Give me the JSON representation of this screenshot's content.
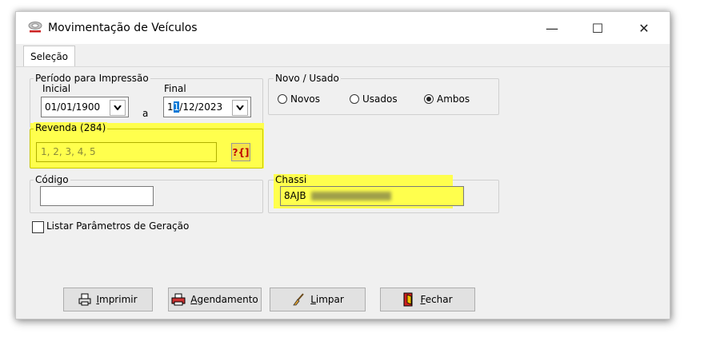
{
  "window": {
    "title": "Movimentação de Veículos",
    "controls": {
      "minimize": "—",
      "maximize": "☐",
      "close": "✕"
    }
  },
  "tabs": {
    "selected": "Seleção"
  },
  "periodo": {
    "legend": "Período para Impressão",
    "inicial_label": "Inicial",
    "inicial_value": "01/01/1900",
    "sep": "a",
    "final_label": "Final",
    "final_value_pre": "1",
    "final_value_sel": "1",
    "final_value_post": "/12/2023"
  },
  "novo_usado": {
    "legend": "Novo / Usado",
    "options": [
      "Novos",
      "Usados",
      "Ambos"
    ],
    "selected": "Ambos"
  },
  "revenda": {
    "legend": "Revenda (284)",
    "value": "1, 2, 3, 4, 5",
    "button_label": "?{]"
  },
  "codigo": {
    "legend": "Código",
    "value": ""
  },
  "chassi": {
    "legend": "Chassi",
    "value": "8AJB"
  },
  "listar": {
    "label": "Listar Parâmetros de Geração",
    "checked": false
  },
  "buttons": {
    "imprimir": "Imprimir",
    "agendamento": "Agendamento",
    "limpar": "Limpar",
    "fechar": "Fechar"
  },
  "colors": {
    "highlight": "#ffff4d",
    "selection": "#0078d7"
  }
}
